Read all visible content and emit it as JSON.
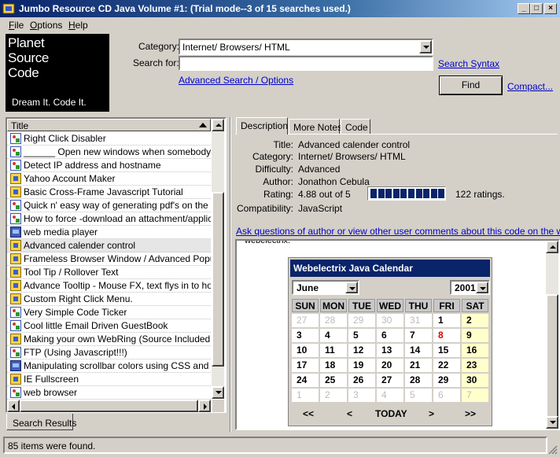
{
  "window": {
    "title": "Jumbo Resource CD Java Volume #1: (Trial mode--3 of 15 searches used.)"
  },
  "menu": [
    {
      "label": "File",
      "u": "F",
      "rest": "ile"
    },
    {
      "label": "Options",
      "u": "O",
      "rest": "ptions"
    },
    {
      "label": "Help",
      "u": "H",
      "rest": "elp"
    }
  ],
  "logo": {
    "line1": "Planet",
    "line2": "Source",
    "line3": "Code",
    "tagline": "Dream It.  Code It."
  },
  "search": {
    "category_label": "Category:",
    "category_value": "Internet/ Browsers/ HTML",
    "searchfor_label": "Search for:",
    "searchfor_value": "",
    "search_syntax": "Search Syntax",
    "advanced": "Advanced Search / Options",
    "find": "Find",
    "compact": "Compact..."
  },
  "list": {
    "header": "Title",
    "items": [
      {
        "title": "Right Click Disabler",
        "icon": "script-icon"
      },
      {
        "title": "______ Open new windows when somebody leave",
        "icon": "script-icon"
      },
      {
        "title": "Detect IP address and hostname",
        "icon": "script-icon"
      },
      {
        "title": "Yahoo Account Maker",
        "icon": "java-icon"
      },
      {
        "title": "Basic Cross-Frame Javascript Tutorial",
        "icon": "java-icon"
      },
      {
        "title": "Quick n' easy way of generating pdf's on the fly usi",
        "icon": "script-icon"
      },
      {
        "title": "How to force -download an attachment/application",
        "icon": "script-icon"
      },
      {
        "title": "web media player",
        "icon": "book-icon"
      },
      {
        "title": "Advanced calender control",
        "icon": "java-icon",
        "selected": true
      },
      {
        "title": "Frameless Browser Window / Advanced Popup W",
        "icon": "java-icon"
      },
      {
        "title": "Tool Tip / Rollover Text",
        "icon": "java-icon"
      },
      {
        "title": "Advance Tooltip - Mouse FX, text flys in to hover u",
        "icon": "java-icon"
      },
      {
        "title": "Custom Right Click Menu.",
        "icon": "java-icon"
      },
      {
        "title": "Very Simple Code Ticker",
        "icon": "script-icon"
      },
      {
        "title": "Cool little Email Driven GuestBook",
        "icon": "script-icon"
      },
      {
        "title": "Making your own WebRing (Source Included!!!!)",
        "icon": "java-icon"
      },
      {
        "title": "FTP (Using Javascript!!!)",
        "icon": "script-icon"
      },
      {
        "title": "Manipulating scrollbar colors using CSS and JavaS",
        "icon": "book-icon"
      },
      {
        "title": "IE Fullscreen",
        "icon": "java-icon"
      },
      {
        "title": "web browser",
        "icon": "script-icon"
      }
    ],
    "tab": "Search Results"
  },
  "detail": {
    "tabs": [
      "Description",
      "More Notes",
      "Code"
    ],
    "fields": [
      {
        "label": "Title:",
        "value": "Advanced calender control"
      },
      {
        "label": "Category:",
        "value": "Internet/ Browsers/ HTML"
      },
      {
        "label": "Difficulty:",
        "value": "Advanced"
      },
      {
        "label": "Author:",
        "value": "Jonathon Cebula"
      },
      {
        "label": "Rating:",
        "value": "4.88 out of 5"
      },
      {
        "label": "Compatibility:",
        "value": "JavaScript"
      }
    ],
    "rating_fraction": 0.976,
    "ratings_count": "122 ratings.",
    "ask_link": "Ask questions of author or view other user comments about this code on the web...",
    "browser_fragment": "webelectrix."
  },
  "calendar": {
    "header": "Webelectrix Java Calendar",
    "month": "June",
    "year": "2001",
    "days": [
      "SUN",
      "MON",
      "TUE",
      "WED",
      "THU",
      "FRI",
      "SAT"
    ],
    "weeks": [
      [
        "27",
        "28",
        "29",
        "30",
        "31",
        "1",
        "2"
      ],
      [
        "3",
        "4",
        "5",
        "6",
        "7",
        "8",
        "9"
      ],
      [
        "10",
        "11",
        "12",
        "13",
        "14",
        "15",
        "16"
      ],
      [
        "17",
        "18",
        "19",
        "20",
        "21",
        "22",
        "23"
      ],
      [
        "24",
        "25",
        "26",
        "27",
        "28",
        "29",
        "30"
      ],
      [
        "1",
        "2",
        "3",
        "4",
        "5",
        "6",
        "7"
      ]
    ],
    "nav": [
      "<<",
      "<",
      "TODAY",
      ">",
      ">>"
    ]
  },
  "status": {
    "text": "85 items were found."
  }
}
